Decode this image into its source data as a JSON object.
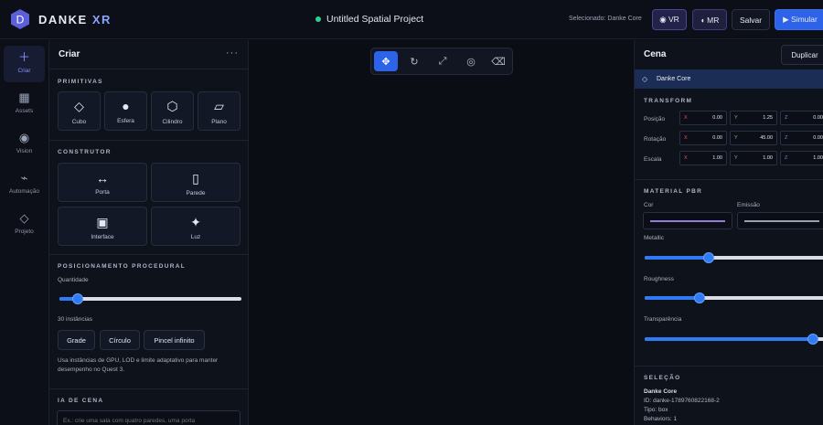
{
  "topbar": {
    "brand_main": "DANKE",
    "brand_accent": "XR",
    "logo_letter": "D",
    "project_name": "Untitled Spatial Project",
    "selected_label": "Selecionado: Danke Core",
    "vr_label": "◉ VR",
    "mr_label": "◖ MR",
    "save_label": "Salvar",
    "simulate_label": "▶ Simular"
  },
  "rail": {
    "items": [
      {
        "label": "Criar",
        "icon": "plus-icon"
      },
      {
        "label": "Assets",
        "icon": "grid-icon"
      },
      {
        "label": "Vision",
        "icon": "eye-icon"
      },
      {
        "label": "Automação",
        "icon": "automation-icon"
      },
      {
        "label": "Projeto",
        "icon": "diamond-icon"
      }
    ]
  },
  "left_panel": {
    "title": "Criar",
    "menu": "···",
    "primitives_title": "PRIMITIVAS",
    "primitives": [
      {
        "label": "Cubo",
        "icon": "◇"
      },
      {
        "label": "Esfera",
        "icon": "●"
      },
      {
        "label": "Cilindro",
        "icon": "⬡"
      },
      {
        "label": "Plano",
        "icon": "▱"
      }
    ],
    "builder_title": "CONSTRUTOR",
    "builder": [
      {
        "label": "Porta",
        "icon": "↔"
      },
      {
        "label": "Parede",
        "icon": "▯"
      },
      {
        "label": "Interface",
        "icon": "▣"
      },
      {
        "label": "Luz",
        "icon": "✦"
      }
    ],
    "procedural_title": "POSICIONAMENTO PROCEDURAL",
    "quantity_label": "Quantidade",
    "quantity_fraction": 0.1,
    "instances_text": "30 instâncias",
    "modes": [
      "Grade",
      "Círculo",
      "Pincel infinito"
    ],
    "description": "Usa instâncias de GPU, LOD e limite adaptativo para manter desempenho no Quest 3.",
    "ai_title": "IA DE CENA",
    "ai_placeholder": "Ex.: crie uma sala com quatro paredes, uma porta"
  },
  "viewport": {
    "tools": [
      {
        "name": "move-tool",
        "glyph": "✥"
      },
      {
        "name": "rotate-tool",
        "glyph": "↻"
      },
      {
        "name": "scale-tool",
        "glyph": "⤢"
      },
      {
        "name": "focus-tool",
        "glyph": "◎"
      },
      {
        "name": "delete-tool",
        "glyph": "⌫"
      }
    ]
  },
  "right_panel": {
    "title": "Cena",
    "duplicate_label": "Duplicar",
    "scene_item": "Danke Core",
    "transform_title": "TRANSFORM",
    "position_label": "Posição",
    "rotation_label": "Rotação",
    "scale_label": "Escala",
    "axes": [
      "X",
      "Y",
      "Z"
    ],
    "position": [
      "0.00",
      "1.25",
      "0.00"
    ],
    "rotation": [
      "0.00",
      "45.00",
      "0.00"
    ],
    "scale": [
      "1.00",
      "1.00",
      "1.00"
    ],
    "material_title": "MATERIAL PBR",
    "color_label": "Cor",
    "emission_label": "Emissão",
    "color_value": "#8f7fd6",
    "emission_value": "#9aa0ad",
    "metallic_label": "Metallic",
    "metallic_fraction": 0.35,
    "roughness_label": "Roughness",
    "roughness_fraction": 0.3,
    "transparency_label": "Transparência",
    "transparency_fraction": 0.92,
    "selection_title": "SELEÇÃO",
    "sel_name": "Danke Core",
    "sel_id": "ID: danke-1789760822168-2",
    "sel_type": "Tipo: box",
    "sel_behaviors": "Behaviors: 1"
  },
  "colors": {
    "accent": "#2c63e9",
    "status_dot": "#2fd08a"
  }
}
